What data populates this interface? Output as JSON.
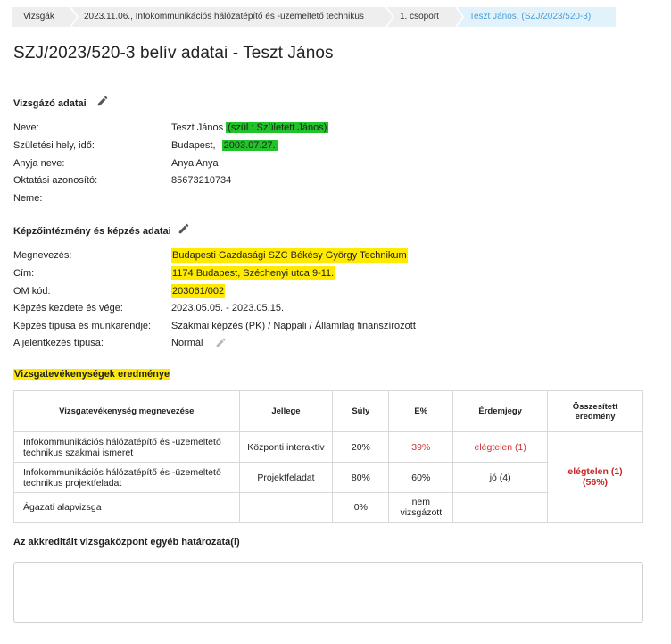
{
  "breadcrumb": [
    "Vizsgák",
    "2023.11.06., Infokommunikációs hálózatépítő és -üzemeltető technikus",
    "1. csoport",
    "Teszt János, (SZJ/2023/520-3)"
  ],
  "page_title": "SZJ/2023/520-3 belív adatai - Teszt János",
  "examinee": {
    "section_title": "Vizsgázó adatai",
    "name_label": "Neve:",
    "name_value": "Teszt János",
    "name_note": "(szül.: Született János)",
    "birth_label": "Születési hely, idő:",
    "birth_place": "Budapest,",
    "birth_date": "2003.07.27.",
    "mother_label": "Anyja neve:",
    "mother_value": "Anya Anya",
    "edu_id_label": "Oktatási azonosító:",
    "edu_id_value": "85673210734",
    "gender_label": "Neme:",
    "gender_value": ""
  },
  "institution": {
    "section_title": "Képzőintézmény és képzés adatai",
    "name_label": "Megnevezés:",
    "name_value": "Budapesti Gazdasági SZC Békésy György Technikum",
    "address_label": "Cím:",
    "address_value": "1174 Budapest, Széchenyi utca 9-11.",
    "om_label": "OM kód:",
    "om_value": "203061/002",
    "period_label": "Képzés kezdete és vége:",
    "period_value": "2023.05.05. - 2023.05.15.",
    "type_label": "Képzés típusa és munkarendje:",
    "type_value": "Szakmai képzés (PK) / Nappali / Államilag finanszírozott",
    "application_label": "A jelentkezés típusa:",
    "application_value": "Normál"
  },
  "results": {
    "section_title": "Vizsgatevékenységek eredménye",
    "headers": {
      "name": "Vizsgatevékenység megnevezése",
      "type": "Jellege",
      "weight": "Súly",
      "percent": "E%",
      "grade": "Érdemjegy",
      "total": "Összesített eredmény"
    },
    "rows": [
      {
        "name": "Infokommunikációs hálózatépítő és -üzemeltető technikus szakmai ismeret",
        "type": "Központi interaktív",
        "weight": "20%",
        "percent": "39%",
        "grade": "elégtelen (1)"
      },
      {
        "name": "Infokommunikációs hálózatépítő és -üzemeltető technikus projektfeladat",
        "type": "Projektfeladat",
        "weight": "80%",
        "percent": "60%",
        "grade": "jó (4)"
      },
      {
        "name": "Ágazati alapvizsga",
        "type": "",
        "weight": "0%",
        "percent": "nem vizsgázott",
        "grade": ""
      }
    ],
    "total_line1": "elégtelen (1)",
    "total_line2": "(56%)"
  },
  "decision": {
    "section_title": "Az akkreditált vizsgaközpont egyéb határozata(i)",
    "value": ""
  },
  "colors": {
    "highlight_green": "#22c22a",
    "highlight_yellow": "#ffea00",
    "fail_red": "#d32f2f",
    "breadcrumb_active_text": "#4a9fd4",
    "breadcrumb_active_bg": "#e1f2fb"
  },
  "icons": [
    "pencil-icon"
  ]
}
